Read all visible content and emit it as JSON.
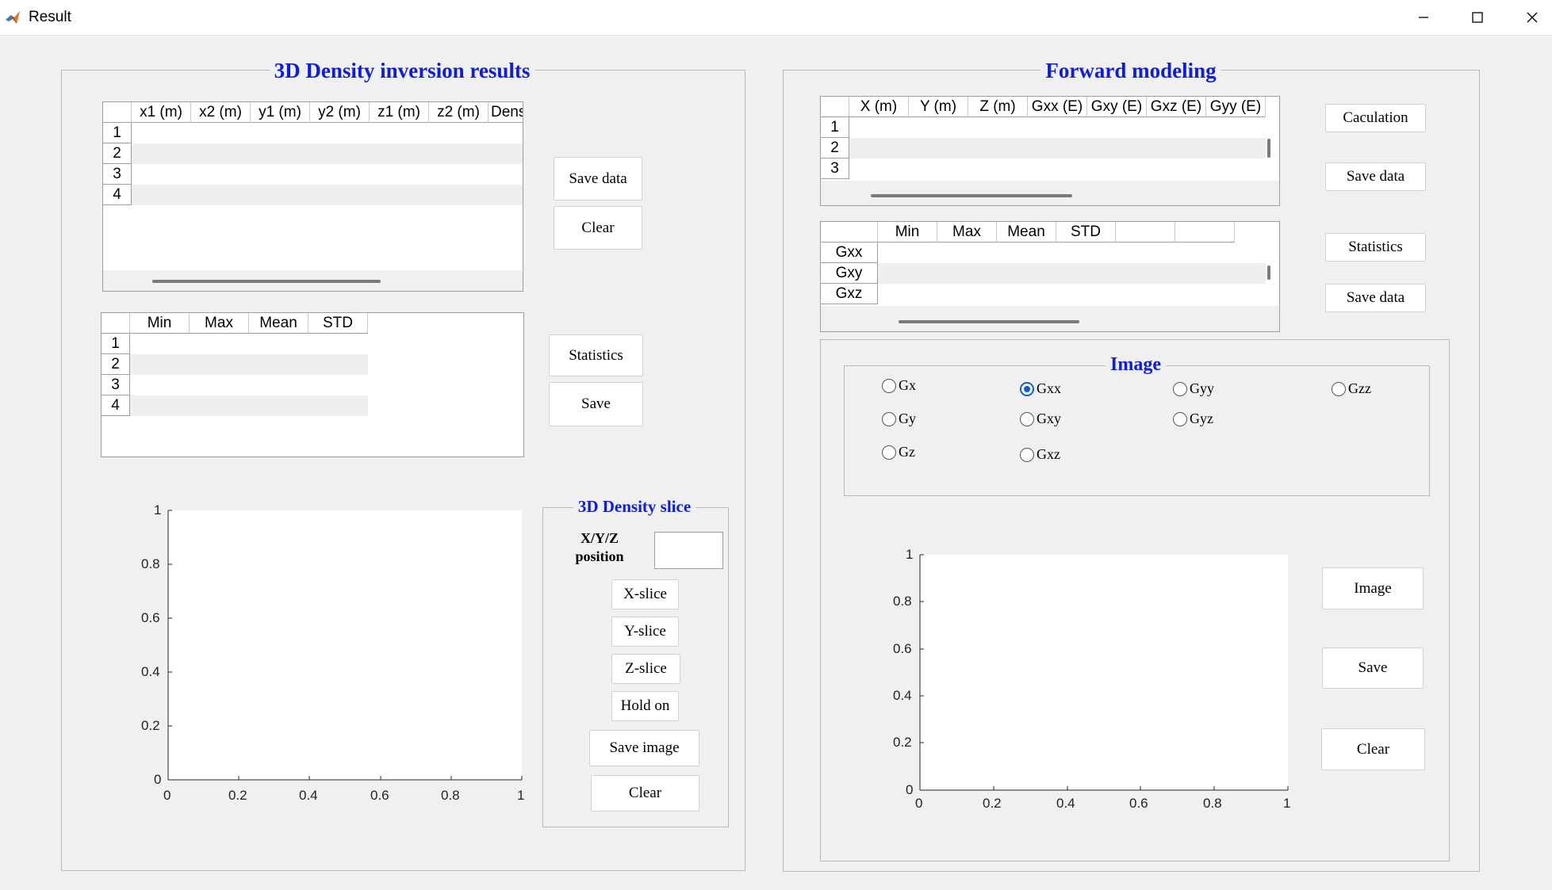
{
  "window": {
    "title": "Result",
    "icon": "matlab-icon",
    "controls": [
      "minimize-icon",
      "maximize-icon",
      "close-icon"
    ]
  },
  "left_panel": {
    "title": "3D Density inversion results",
    "results_table": {
      "columns": [
        "x1 (m)",
        "x2 (m)",
        "y1 (m)",
        "y2 (m)",
        "z1 (m)",
        "z2 (m)",
        "Dens"
      ],
      "rows": [
        "1",
        "2",
        "3",
        "4"
      ]
    },
    "save_data_label": "Save data",
    "clear_label": "Clear",
    "stats_table": {
      "columns": [
        "Min",
        "Max",
        "Mean",
        "STD"
      ],
      "rows": [
        "1",
        "2",
        "3",
        "4"
      ]
    },
    "statistics_label": "Statistics",
    "save_label": "Save",
    "axes": {
      "x_ticks": [
        "0",
        "0.2",
        "0.4",
        "0.6",
        "0.8",
        "1"
      ],
      "y_ticks": [
        "0",
        "0.2",
        "0.4",
        "0.6",
        "0.8",
        "1"
      ]
    },
    "slice_panel": {
      "title": "3D Density slice",
      "position_label_line1": "X/Y/Z",
      "position_label_line2": "position",
      "position_value": "",
      "x_slice_label": "X-slice",
      "y_slice_label": "Y-slice",
      "z_slice_label": "Z-slice",
      "hold_on_label": "Hold on",
      "save_image_label": "Save image",
      "clear_label": "Clear"
    }
  },
  "right_panel": {
    "title": "Forward modeling",
    "forward_table": {
      "columns": [
        "X (m)",
        "Y (m)",
        "Z (m)",
        "Gxx (E)",
        "Gxy (E)",
        "Gxz (E)",
        "Gyy (E)"
      ],
      "rows": [
        "1",
        "2",
        "3"
      ]
    },
    "calculation_label": "Caculation",
    "save_data_label": "Save data",
    "stats_table": {
      "columns": [
        "Min",
        "Max",
        "Mean",
        "STD",
        "",
        ""
      ],
      "rows": [
        "Gxx",
        "Gxy",
        "Gxz"
      ]
    },
    "statistics_label": "Statistics",
    "save_data2_label": "Save data",
    "image_group": {
      "title": "Image",
      "options": [
        "Gx",
        "Gxx",
        "Gyy",
        "Gzz",
        "Gy",
        "Gxy",
        "Gyz",
        "Gz",
        "Gxz"
      ],
      "selected": "Gxx"
    },
    "axes": {
      "x_ticks": [
        "0",
        "0.2",
        "0.4",
        "0.6",
        "0.8",
        "1"
      ],
      "y_ticks": [
        "0",
        "0.2",
        "0.4",
        "0.6",
        "0.8",
        "1"
      ]
    },
    "image_label": "Image",
    "save_label": "Save",
    "clear_label": "Clear"
  },
  "colors": {
    "panel_title": "#0c1be6",
    "radio_selected": "#0b5cd5",
    "background": "#f0f0f0"
  }
}
